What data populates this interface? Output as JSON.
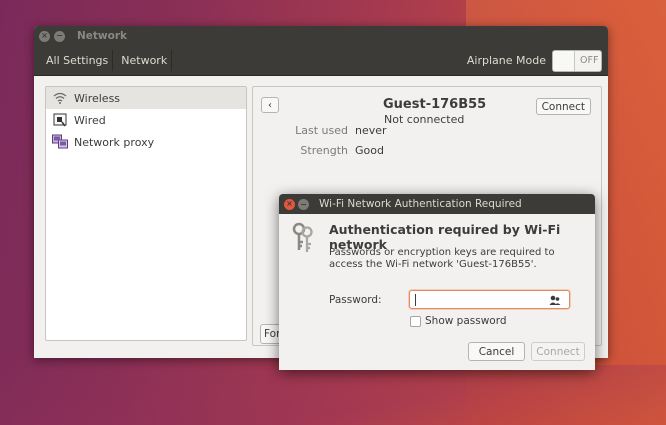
{
  "window": {
    "title": "Network",
    "breadcrumbs": [
      "All Settings",
      "Network"
    ],
    "airplane_mode": {
      "label": "Airplane Mode",
      "state": "OFF"
    }
  },
  "sidebar": {
    "items": [
      {
        "label": "Wireless",
        "icon": "wireless-icon",
        "selected": true
      },
      {
        "label": "Wired",
        "icon": "wired-icon",
        "selected": false
      },
      {
        "label": "Network proxy",
        "icon": "network-proxy-icon",
        "selected": false
      }
    ],
    "add_label": "+",
    "remove_label": "−"
  },
  "detail": {
    "network_name": "Guest-176B55",
    "status": "Not connected",
    "connect_label": "Connect",
    "properties": [
      {
        "label": "Last used",
        "value": "never"
      },
      {
        "label": "Strength",
        "value": "Good"
      }
    ],
    "forget_label": "For"
  },
  "dialog": {
    "title": "Wi-Fi Network Authentication Required",
    "heading": "Authentication required by Wi-Fi network",
    "message": "Passwords or encryption keys are required to access the Wi-Fi network 'Guest-176B55'.",
    "password_label": "Password:",
    "password_value": "",
    "show_password_label": "Show password",
    "show_password_checked": false,
    "cancel_label": "Cancel",
    "connect_label": "Connect"
  },
  "colors": {
    "titlebar": "#3c3b37",
    "window_bg": "#f2f1f0",
    "focus_orange": "#e98a5e",
    "close_button": "#e2583e"
  }
}
